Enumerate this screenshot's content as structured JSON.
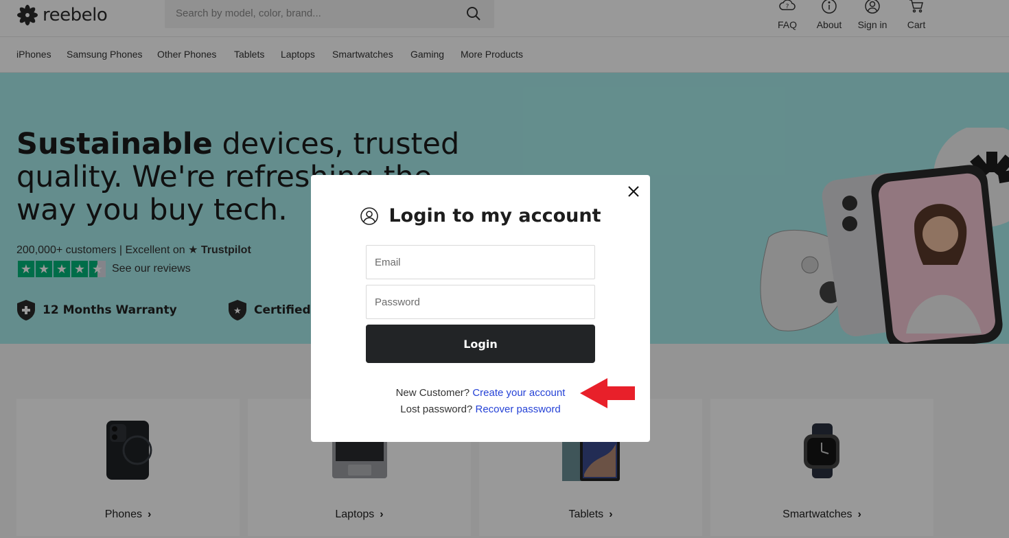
{
  "brand": {
    "name": "reebelo",
    "logo_icon": "flower-logo-icon"
  },
  "search": {
    "placeholder": "Search by model, color, brand..."
  },
  "header_links": [
    {
      "label": "FAQ",
      "icon": "faq-cloud-icon"
    },
    {
      "label": "About",
      "icon": "info-icon"
    },
    {
      "label": "Sign in",
      "icon": "user-icon"
    },
    {
      "label": "Cart",
      "icon": "cart-icon"
    }
  ],
  "nav": [
    "iPhones",
    "Samsung Phones",
    "Other Phones",
    "Tablets",
    "Laptops",
    "Smartwatches",
    "Gaming",
    "More Products"
  ],
  "hero": {
    "title_bold": "Sustainable",
    "title_rest": " devices, trusted quality. We're refreshing the way you buy tech.",
    "customers": "200,000+ customers | Excellent on",
    "trustpilot": "Trustpilot",
    "reviews_link": "See our reviews",
    "badges": [
      "12 Months Warranty",
      "Certified"
    ],
    "stars": 4.5
  },
  "categories": [
    {
      "label": "Phones"
    },
    {
      "label": "Laptops"
    },
    {
      "label": "Tablets"
    },
    {
      "label": ""
    },
    {
      "label": "Smartwatches"
    }
  ],
  "modal": {
    "title": "Login to my account",
    "email_placeholder": "Email",
    "password_placeholder": "Password",
    "login_label": "Login",
    "new_customer_text": "New Customer?",
    "create_account_link": "Create your account",
    "lost_password_text": "Lost password?",
    "recover_link": "Recover password"
  },
  "colors": {
    "hero_bg": "#a7eceb",
    "button_dark": "#222426",
    "link_blue": "#2542d6",
    "annotation_red": "#e8202a",
    "trustpilot_green": "#00b67a"
  }
}
